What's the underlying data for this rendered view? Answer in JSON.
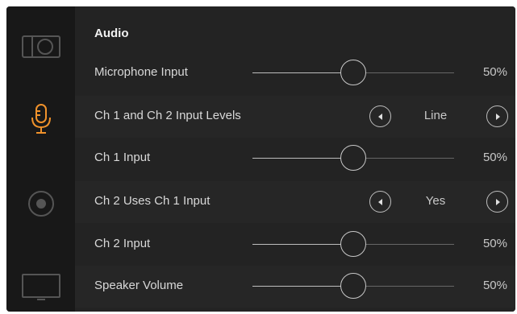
{
  "sidebar": {
    "items": [
      {
        "icon": "camera-icon",
        "active": false
      },
      {
        "icon": "microphone-icon",
        "active": true
      },
      {
        "icon": "record-icon",
        "active": false
      },
      {
        "icon": "monitor-icon",
        "active": false
      }
    ]
  },
  "main": {
    "title": "Audio",
    "rows": [
      {
        "label": "Microphone Input",
        "type": "slider",
        "value": "50%",
        "level": 0.5
      },
      {
        "label": "Ch 1 and Ch 2 Input Levels",
        "type": "choice",
        "value": "Line"
      },
      {
        "label": "Ch 1 Input",
        "type": "slider",
        "value": "50%",
        "level": 0.5
      },
      {
        "label": "Ch 2 Uses Ch 1 Input",
        "type": "choice",
        "value": "Yes"
      },
      {
        "label": "Ch 2 Input",
        "type": "slider",
        "value": "50%",
        "level": 0.5
      },
      {
        "label": "Speaker Volume",
        "type": "slider",
        "value": "50%",
        "level": 0.5
      }
    ]
  },
  "colors": {
    "accent": "#f0922b",
    "icon_inactive": "#555555",
    "background": "#232323",
    "sidebar": "#181818",
    "text": "#d8d8d8"
  }
}
